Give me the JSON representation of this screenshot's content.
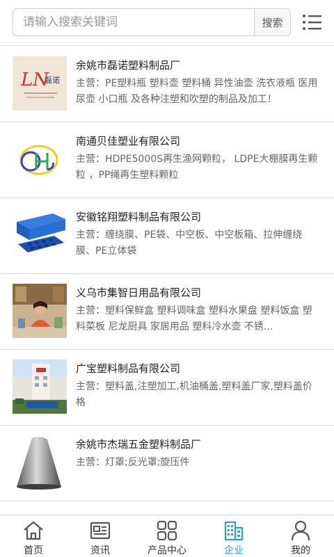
{
  "search": {
    "placeholder": "请输入搜索关键词",
    "button_label": "搜索"
  },
  "companies": [
    {
      "name": "余姚市磊诺塑料制品厂",
      "desc": "主营：PE塑料瓶 塑料壶 塑料桶 异性油壶 洗衣液瓶 医用尿壶 小口瓶 及各种注塑和吹塑的制品及加工！",
      "logo_text": "磊诺"
    },
    {
      "name": "南通贝佳塑业有限公司",
      "desc": "主营：HDPE5000S再生渔网颗粒， LDPE大棚膜再生颗粒 ，PP绳再生塑料颗粒"
    },
    {
      "name": "安徽铭翔塑料制品有限公司",
      "desc": "主营：缠绕膜、PE袋、中空板、中空板箱、拉伸缠绕膜、PE立体袋"
    },
    {
      "name": "义乌市集智日用品有限公司",
      "desc": "主营：塑料保鲜盒 塑料调味盒 塑料水果盘 塑料饭盒 塑料菜板 尼龙厨具 家居用品 塑料冷水壶 不锈..."
    },
    {
      "name": "广宝塑料制品有限公司",
      "desc": "主营：塑料盖,注塑加工,机油桶盖,塑料盖厂家,塑料盖价格"
    },
    {
      "name": "余姚市杰瑞五金塑料制品厂",
      "desc": "主营：灯罩;反光罩;旋压件"
    }
  ],
  "tabbar": [
    {
      "label": "首页",
      "icon": "home-icon",
      "active": false
    },
    {
      "label": "资讯",
      "icon": "news-icon",
      "active": false
    },
    {
      "label": "产品中心",
      "icon": "grid-icon",
      "active": false
    },
    {
      "label": "企业",
      "icon": "building-icon",
      "active": true
    },
    {
      "label": "我的",
      "icon": "user-icon",
      "active": false
    }
  ],
  "colors": {
    "accent": "#2a9fd8",
    "divider": "#dcdcdc"
  }
}
